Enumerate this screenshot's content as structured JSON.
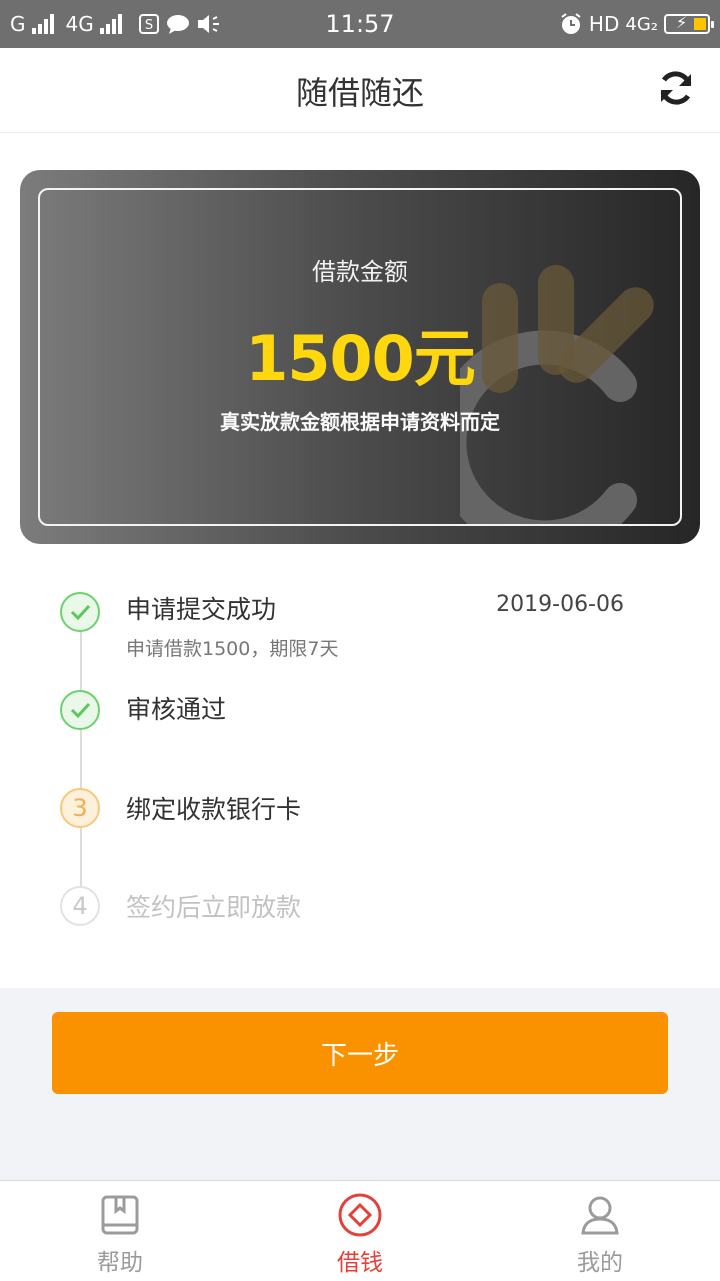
{
  "status_bar": {
    "carrier_1": "G",
    "carrier_2": "4G",
    "time": "11:57",
    "hd": "HD",
    "net": "4G₂"
  },
  "header": {
    "title": "随借随还",
    "refresh_icon": "refresh-icon"
  },
  "card": {
    "label": "借款金额",
    "amount": "1500元",
    "note": "真实放款金额根据申请资料而定",
    "accent_color": "#ffd70f"
  },
  "steps": [
    {
      "title": "申请提交成功",
      "date": "2019-06-06",
      "sub": "申请借款1500，期限7天",
      "state": "done"
    },
    {
      "title": "审核通过",
      "state": "done"
    },
    {
      "number": "3",
      "title": "绑定收款银行卡",
      "state": "current"
    },
    {
      "number": "4",
      "title": "签约后立即放款",
      "state": "pending"
    }
  ],
  "actions": {
    "next_label": "下一步",
    "next_color": "#fa9200"
  },
  "tabbar": {
    "items": [
      {
        "label": "帮助",
        "icon": "book-icon",
        "active": false
      },
      {
        "label": "借钱",
        "icon": "diamond-icon",
        "active": true
      },
      {
        "label": "我的",
        "icon": "user-icon",
        "active": false
      }
    ],
    "active_color": "#e5403a",
    "inactive_color": "#999999"
  }
}
